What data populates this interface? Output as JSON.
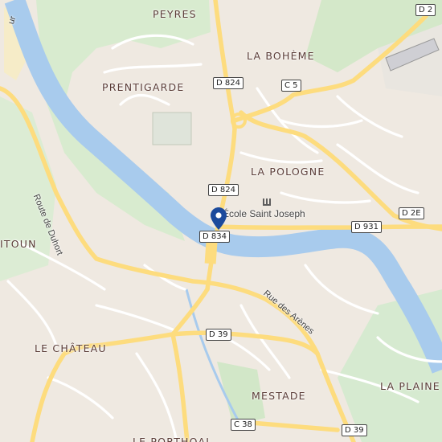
{
  "places": {
    "peyres": "PEYRES",
    "la_boheme": "LA BOHÈME",
    "prentigarde": "PRENTIGARDE",
    "la_pologne": "LA POLOGNE",
    "itoun": "ITOUN",
    "le_chateau": "LE CHÂTEAU",
    "mestade": "MESTADE",
    "la_plaine": "LA PLAINE",
    "le_porthoal": "LE PORTHOAL"
  },
  "roads": {
    "d2": "D 2",
    "d824_top": "D 824",
    "c5": "C 5",
    "d824_mid": "D 824",
    "d834": "D 834",
    "d931": "D 931",
    "d2e": "D 2E",
    "d39_mid": "D 39",
    "c38": "C 38",
    "d39_bottom": "D 39"
  },
  "streets": {
    "route_de_duhort": "Route de Duhort",
    "rue_des_arenes": "Rue des Arènes",
    "edge_partial": "ur"
  },
  "pois": {
    "ecole": "École Saint Joseph"
  },
  "colors": {
    "land": "#efe9e1",
    "water": "#a8cbed",
    "park": "#c8e2c0",
    "major_road": "#fddc7e",
    "minor_road": "#ffffff",
    "pin": "#1c4a9c"
  },
  "icons": {
    "pin": "map-pin-icon",
    "school": "school-icon"
  }
}
